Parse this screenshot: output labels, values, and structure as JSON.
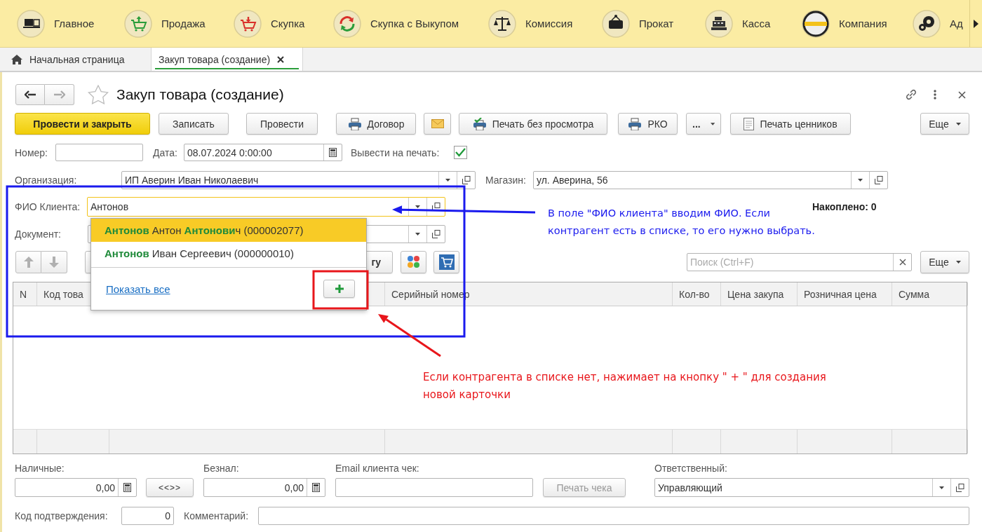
{
  "top_nav": {
    "items": [
      {
        "label": "Главное",
        "kind": "computer"
      },
      {
        "label": "Продажа",
        "kind": "cart-up"
      },
      {
        "label": "Скупка",
        "kind": "cart-down"
      },
      {
        "label": "Скупка с Выкупом",
        "kind": "cycle"
      },
      {
        "label": "Комиссия",
        "kind": "scales"
      },
      {
        "label": "Прокат",
        "kind": "sign"
      },
      {
        "label": "Касса",
        "kind": "register"
      },
      {
        "label": "Компания",
        "kind": "logo"
      },
      {
        "label": "Ад",
        "kind": "gears"
      }
    ]
  },
  "tabs": [
    {
      "label": "Начальная страница",
      "kind": "home",
      "selected": false
    },
    {
      "label": "Закуп товара (создание)",
      "kind": "document",
      "selected": true
    }
  ],
  "form": {
    "title": "Закуп товара (создание)",
    "toolbar": [
      {
        "label": "Провести и закрыть",
        "kind": "primary"
      },
      {
        "label": "Записать",
        "kind": "plain"
      },
      {
        "label": "Провести",
        "kind": "plain"
      },
      {
        "label": "Договор",
        "kind": "printer"
      },
      {
        "kind": "envelope"
      },
      {
        "label": "Печать без просмотра",
        "kind": "printer-check"
      },
      {
        "label": "РКО",
        "kind": "printer"
      },
      {
        "label": "...",
        "kind": "dropdown"
      },
      {
        "label": "Печать ценников",
        "kind": "sheet"
      }
    ],
    "more": "Еще",
    "number": {
      "label": "Номер:"
    },
    "date": {
      "label": "Дата:",
      "value": "08.07.2024  0:00:00"
    },
    "print": {
      "label": "Вывести на печать:",
      "checked": true
    },
    "organization": {
      "label": "Организация:",
      "value": "ИП Аверин Иван Николаевич"
    },
    "shop": {
      "label": "Магазин:",
      "value": "ул. Аверина, 56"
    },
    "client": {
      "label": "ФИО Клиента:",
      "value": "Антонов"
    },
    "accumulated": "Накоплено: 0",
    "document": {
      "label": "Документ:"
    },
    "table_toolbar": {
      "partial_button": "гу",
      "search_placeholder": "Поиск (Ctrl+F)",
      "more": "Еще"
    },
    "table": {
      "columns": [
        "N",
        "Код това",
        "Серийный номер",
        "Кол-во",
        "Цена закупа",
        "Розничная цена",
        "Сумма"
      ]
    },
    "cash": {
      "label": "Наличные:",
      "value": "0,00"
    },
    "swap": "<<>>",
    "noncash": {
      "label": "Безнал:",
      "value": "0,00"
    },
    "email": {
      "label": "Email клиента чек:"
    },
    "print_receipt": {
      "label": "Печать чека",
      "disabled": true
    },
    "responsible": {
      "label": "Ответственный:",
      "value": "Управляющий"
    },
    "confirmation_code": {
      "label": "Код подтверждения:",
      "value": "0"
    },
    "comment": {
      "label": "Комментарий:"
    }
  },
  "popup": {
    "items": [
      {
        "text": "**Антонов** Антон **Антонови**ч (000002077)",
        "selected": true
      },
      {
        "text": "**Антонов** Иван Сергеевич (000000010)",
        "selected": false
      }
    ],
    "show_all": "Показать все"
  },
  "annotations": [
    {
      "kind": "blue",
      "lines": [
        "В поле \"ФИО клиента\" вводим ФИО. Если",
        "контрагент есть в списке, то его нужно выбрать."
      ]
    },
    {
      "kind": "red",
      "lines": [
        "Если контрагента в списке нет, нажимает на кнопку \" + \" для создания",
        "новой карточки"
      ]
    }
  ]
}
